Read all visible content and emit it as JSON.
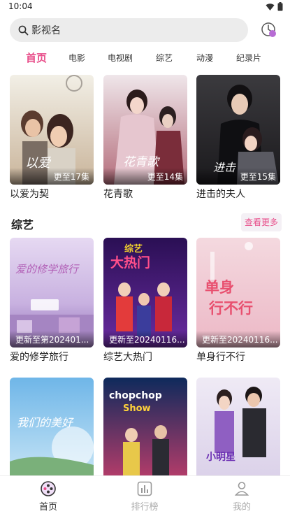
{
  "status": {
    "time": "10:04"
  },
  "search": {
    "placeholder": "影视名"
  },
  "categories": [
    "首页",
    "电影",
    "电视剧",
    "综艺",
    "动漫",
    "纪录片"
  ],
  "top_row": [
    {
      "title": "以爱为契",
      "badge": "更至17集"
    },
    {
      "title": "花青歌",
      "badge": "更至14集"
    },
    {
      "title": "进击的夫人",
      "badge": "更至15集"
    }
  ],
  "variety_section": {
    "title": "综艺",
    "more_label": "查看更多",
    "items": [
      {
        "title": "爱的修学旅行",
        "badge": "更新至第202401..."
      },
      {
        "title": "综艺大热门",
        "badge": "更新至20240116..."
      },
      {
        "title": "单身行不行",
        "badge": "更新至20240116..."
      }
    ]
  },
  "bottom_nav": {
    "home": "首页",
    "ranking": "排行榜",
    "mine": "我的"
  },
  "colors": {
    "accent": "#e84e8a"
  }
}
